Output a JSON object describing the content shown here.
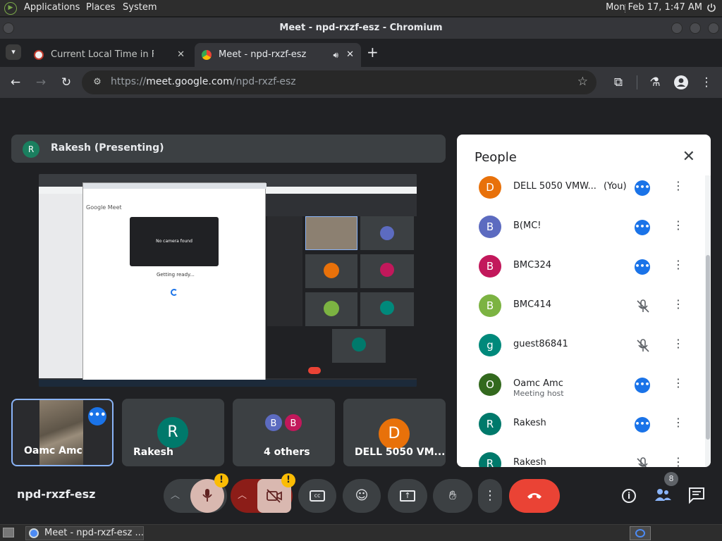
{
  "panel": {
    "applications": "Applications",
    "places": "Places",
    "system": "System",
    "clock": "Mon Feb 17,  1:47 AM"
  },
  "window": {
    "title": "Meet - npd-rxzf-esz - Chromium"
  },
  "tabs": [
    {
      "label": "Current Local Time in Fall Riv",
      "close": "✕"
    },
    {
      "label": "Meet - npd-rxzf-esz",
      "close": "✕"
    }
  ],
  "new_tab": "+",
  "toolbar": {
    "url_scheme": "https://",
    "url_host": "meet.google.com",
    "url_path": "/npd-rxzf-esz"
  },
  "meet": {
    "presenting_avatar": "R",
    "presenting_text": "Rakesh (Presenting)",
    "share_preview": {
      "meet_logo": "Google Meet",
      "no_camera": "No camera found",
      "getting_ready": "Getting ready..."
    },
    "tiles": [
      {
        "name": "Oamc Amc",
        "more": "•••"
      },
      {
        "name": "Rakesh",
        "avatar": "R",
        "color": "#00796b"
      },
      {
        "name": "4 others",
        "avatars": [
          "B",
          "B"
        ],
        "colors": [
          "#5c6bc0",
          "#c2185b"
        ]
      },
      {
        "name": "DELL 5050 VM...",
        "avatar": "D",
        "color": "#e8710a"
      }
    ],
    "meeting_code": "npd-rxzf-esz",
    "warn_badge": "!",
    "participant_count": "8"
  },
  "people": {
    "title": "People",
    "close": "✕",
    "list": [
      {
        "initial": "D",
        "name": "DELL 5050 VMW...",
        "you": "(You)",
        "color": "#e8710a",
        "status": "more"
      },
      {
        "initial": "B",
        "name": "B(MC!",
        "color": "#5c6bc0",
        "status": "more"
      },
      {
        "initial": "B",
        "name": "BMC324",
        "color": "#c2185b",
        "status": "more"
      },
      {
        "initial": "B",
        "name": "BMC414",
        "color": "#7cb342",
        "status": "muted"
      },
      {
        "initial": "g",
        "name": "guest86841",
        "color": "#00897b",
        "status": "muted"
      },
      {
        "initial": "O",
        "name": "Oamc Amc",
        "sub": "Meeting host",
        "color": "#33691e",
        "status": "more"
      },
      {
        "initial": "R",
        "name": "Rakesh",
        "color": "#00796b",
        "status": "more"
      },
      {
        "initial": "R",
        "name": "Rakesh",
        "color": "#00796b",
        "status": "muted"
      }
    ],
    "more_glyph": "•••",
    "menu_glyph": "⋮"
  },
  "taskbar": {
    "window_label": "Meet - npd-rxzf-esz ..."
  }
}
